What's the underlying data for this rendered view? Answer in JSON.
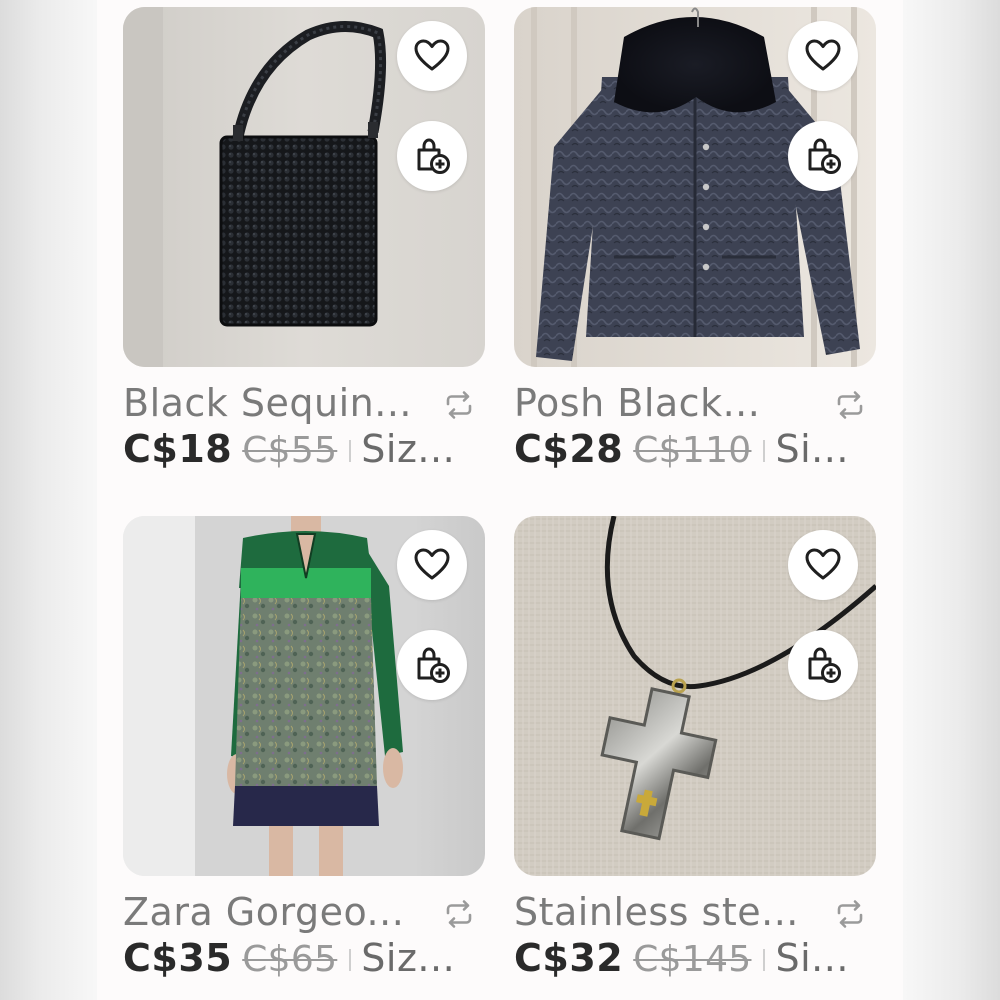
{
  "listings": [
    {
      "title": "Black Sequin...",
      "price": "C$18",
      "original_price": "C$55",
      "size": "Siz...",
      "image": "black-sequin-shoulder-bag"
    },
    {
      "title": "Posh Black...",
      "price": "C$28",
      "original_price": "C$110",
      "size": "Si...",
      "image": "black-quilted-jacket-fur-collar"
    },
    {
      "title": "Zara Gorgeo...",
      "price": "C$35",
      "original_price": "C$65",
      "size": "Siz...",
      "image": "green-paisley-shift-dress"
    },
    {
      "title": "Stainless ste...",
      "price": "C$32",
      "original_price": "C$145",
      "size": "Si...",
      "image": "stainless-steel-cross-pendant"
    }
  ],
  "icons": {
    "like": "heart-icon",
    "add_to_bundle": "shopping-bag-plus-icon",
    "share": "share-repost-icon"
  },
  "colors": {
    "price": "#2a2a2a",
    "original_price": "#9a9a9a",
    "title": "#7a7a7a",
    "button_bg": "#ffffff"
  }
}
